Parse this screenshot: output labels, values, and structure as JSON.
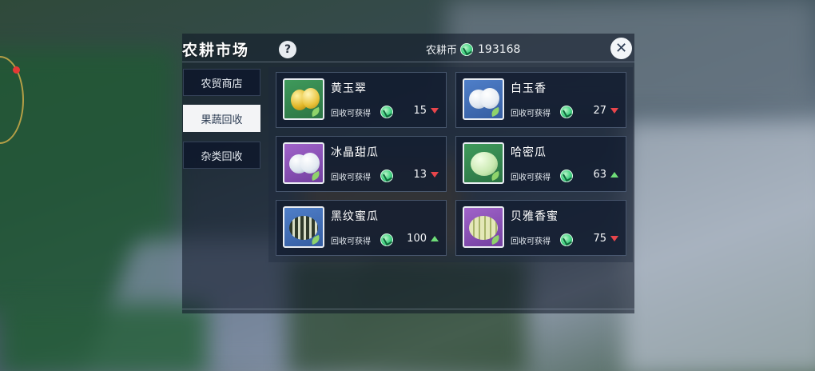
{
  "header": {
    "title": "农耕市场",
    "help_icon": "?",
    "currency_label": "农耕币",
    "currency_amount": "193168",
    "close_icon": "✕"
  },
  "tabs": [
    {
      "label": "农贸商店",
      "active": false
    },
    {
      "label": "果蔬回收",
      "active": true
    },
    {
      "label": "杂类回收",
      "active": false
    }
  ],
  "items": [
    {
      "name": "黄玉翠",
      "gain_label": "回收可获得",
      "value": "15",
      "trend": "down",
      "bg": "green"
    },
    {
      "name": "白玉香",
      "gain_label": "回收可获得",
      "value": "27",
      "trend": "down",
      "bg": "blue"
    },
    {
      "name": "冰晶甜瓜",
      "gain_label": "回收可获得",
      "value": "13",
      "trend": "down",
      "bg": "purple"
    },
    {
      "name": "哈密瓜",
      "gain_label": "回收可获得",
      "value": "63",
      "trend": "up",
      "bg": "green"
    },
    {
      "name": "黑纹蜜瓜",
      "gain_label": "回收可获得",
      "value": "100",
      "trend": "up",
      "bg": "blue"
    },
    {
      "name": "贝雅香蜜",
      "gain_label": "回收可获得",
      "value": "75",
      "trend": "down",
      "bg": "purple"
    }
  ],
  "colors": {
    "trend_up": "#6fdd78",
    "trend_down": "#e8454b",
    "coin": "#3fcf7f"
  }
}
